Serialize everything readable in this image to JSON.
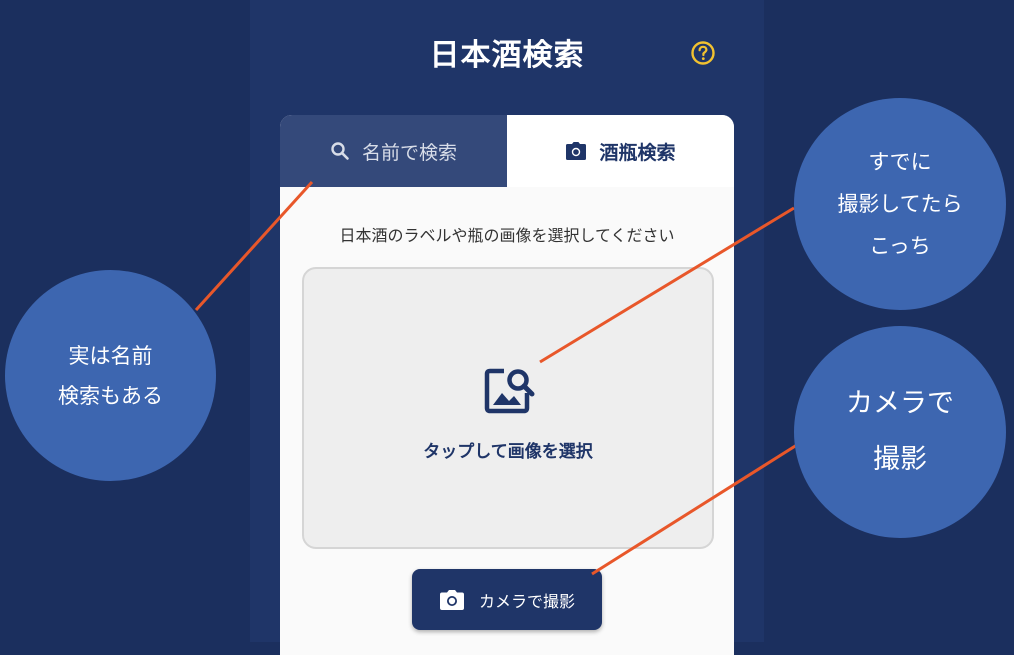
{
  "header": {
    "title": "日本酒検索",
    "help_icon": "help-circle-icon",
    "help_color": "#f2c230"
  },
  "tabs": [
    {
      "label": "名前で検索",
      "icon": "search-icon",
      "selected": false
    },
    {
      "label": "酒瓶検索",
      "icon": "camera-icon",
      "selected": true
    }
  ],
  "main": {
    "instruction": "日本酒のラベルや瓶の画像を選択してください",
    "dropzone_label": "タップして画像を選択",
    "dropzone_icon": "image-search-icon",
    "camera_button_label": "カメラで撮影",
    "camera_button_icon": "camera-icon"
  },
  "annotations": {
    "name_search": "実は名前\n検索もある",
    "existing_photo": "すでに\n撮影してたら\nこっち",
    "camera": "カメラで\n撮影"
  },
  "colors": {
    "background": "#1b2f5e",
    "app_column": "#1f3568",
    "accent": "#1f3568",
    "bubble": "#3d66b0",
    "connector": "#e8572a"
  }
}
